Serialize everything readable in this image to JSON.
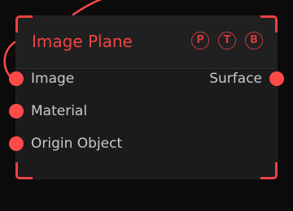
{
  "node": {
    "title": "Image Plane",
    "flags": [
      {
        "label": "P"
      },
      {
        "label": "T"
      },
      {
        "label": "B"
      }
    ],
    "inputs": [
      {
        "label": "Image"
      },
      {
        "label": "Material"
      },
      {
        "label": "Origin Object"
      }
    ],
    "outputs": [
      {
        "label": "Surface"
      }
    ]
  },
  "colors": {
    "accent": "#f04444",
    "port": "#ff4a4a",
    "wire": "#ff4a4a",
    "node_bg": "#1b1b1c",
    "canvas_bg": "#0b0b0c",
    "label": "#c9c9c9"
  }
}
